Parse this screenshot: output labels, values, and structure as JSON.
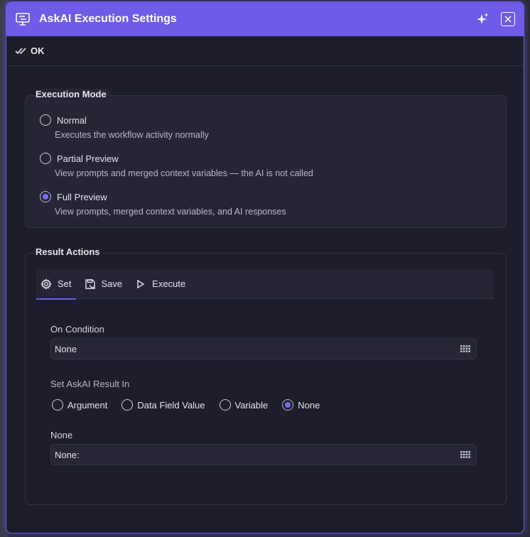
{
  "window": {
    "title": "AskAI Execution Settings"
  },
  "toolbar": {
    "ok_label": "OK"
  },
  "execution_mode": {
    "legend": "Execution Mode",
    "options": [
      {
        "label": "Normal",
        "description": "Executes the workflow activity normally",
        "checked": false
      },
      {
        "label": "Partial Preview",
        "description": "View prompts and merged context variables — the AI is not called",
        "checked": false
      },
      {
        "label": "Full Preview",
        "description": "View prompts, merged context variables, and AI responses",
        "checked": true
      }
    ]
  },
  "result_actions": {
    "legend": "Result Actions",
    "tabs": [
      {
        "label": "Set",
        "icon": "gear-icon",
        "active": true
      },
      {
        "label": "Save",
        "icon": "save-icon",
        "active": false
      },
      {
        "label": "Execute",
        "icon": "play-icon",
        "active": false
      }
    ],
    "on_condition": {
      "label": "On Condition",
      "value": "None"
    },
    "set_result_in": {
      "label": "Set AskAI Result In",
      "options": [
        {
          "label": "Argument",
          "checked": false
        },
        {
          "label": "Data Field Value",
          "checked": false
        },
        {
          "label": "Variable",
          "checked": false
        },
        {
          "label": "None",
          "checked": true
        }
      ]
    },
    "none_field": {
      "label": "None",
      "value": "None:"
    }
  },
  "colors": {
    "accent": "#6c5ce7",
    "background": "#1e1e2a",
    "panel": "#252535",
    "border": "#34344a"
  }
}
